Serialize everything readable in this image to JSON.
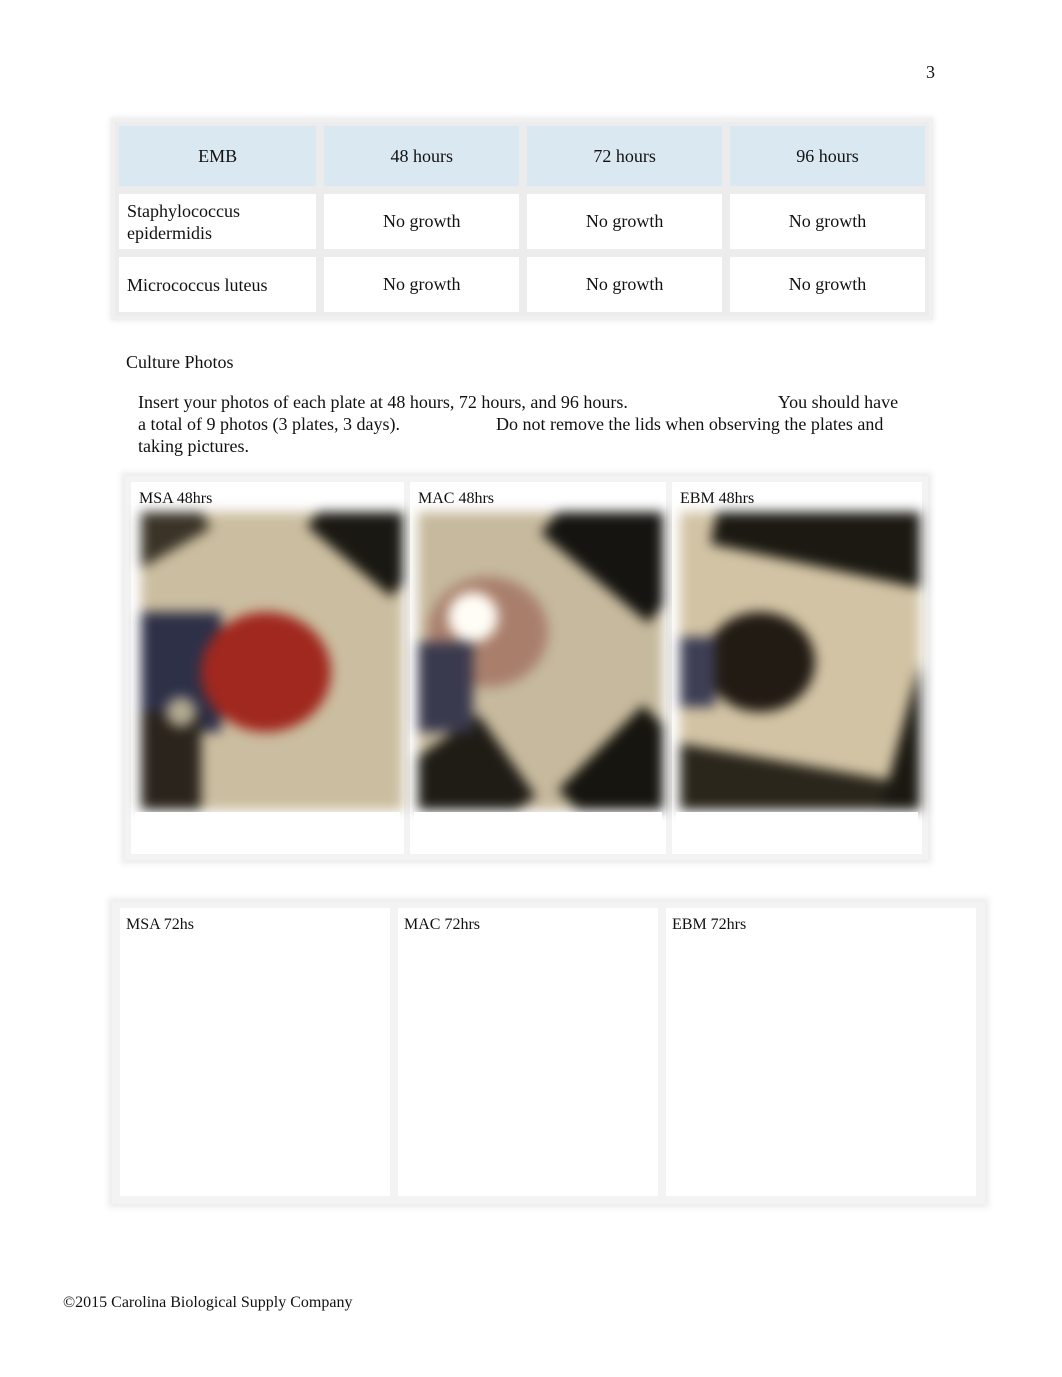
{
  "page": {
    "number": "3"
  },
  "results_table": {
    "headers": [
      "EMB",
      "48 hours",
      "72 hours",
      "96 hours"
    ],
    "rows": [
      {
        "organism": "Staphylococcus epidermidis",
        "values": [
          "No growth",
          "No growth",
          "No growth"
        ]
      },
      {
        "organism": "Micrococcus luteus",
        "values": [
          "No growth",
          "No growth",
          "No growth"
        ]
      }
    ],
    "header_color": "#dae8f1"
  },
  "culture_photos": {
    "heading": "Culture Photos",
    "instructions": {
      "part1": "Insert your photos of each plate at 48 hours, 72 hours, and 96 hours.",
      "part2": "You should have a total of 9 photos (3 plates, 3 days).",
      "part3": "Do not remove the lids when observing the plates and taking pictures."
    },
    "grid_48": [
      {
        "label": "MSA 48hrs",
        "image": "photo of red MSA agar plate on beige surface"
      },
      {
        "label": "MAC 48hrs",
        "image": "photo of MAC agar plate with glare on beige surface"
      },
      {
        "label": "EBM 48hrs",
        "image": "photo of dark EMB agar plate on beige surface"
      }
    ],
    "grid_72": [
      {
        "label": "MSA 72hs"
      },
      {
        "label": "MAC 72hrs"
      },
      {
        "label": "EBM 72hrs"
      }
    ]
  },
  "footer": {
    "copyright": "©2015 Carolina Biological Supply Company"
  }
}
